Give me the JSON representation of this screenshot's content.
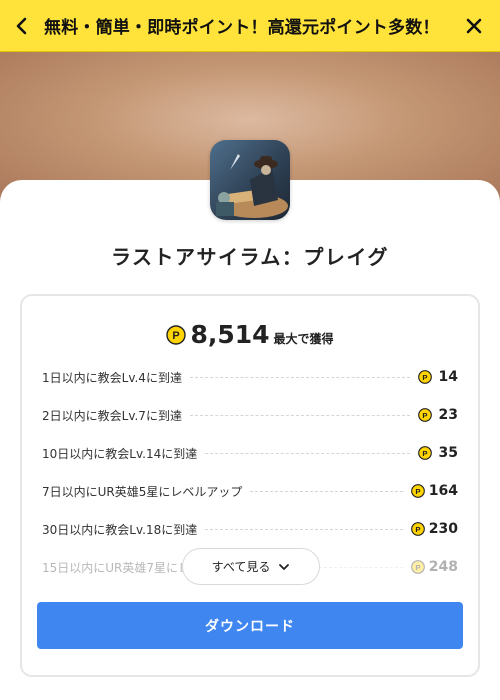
{
  "header": {
    "title": "無料・簡単・即時ポイント！高還元ポイント多数！",
    "back_icon": "chevron-left-icon",
    "close_icon": "close-icon",
    "background_color": "#ffe33a"
  },
  "app": {
    "name": "ラストアサイラム：プレイグ"
  },
  "reward": {
    "total": "8,514",
    "suffix": "最大で獲得",
    "point_icon": "point-coin-icon",
    "missions": [
      {
        "label": "1日以内に教会Lv.4に到達",
        "points": "14"
      },
      {
        "label": "2日以内に教会Lv.7に到達",
        "points": "23"
      },
      {
        "label": "10日以内に教会Lv.14に到達",
        "points": "35"
      },
      {
        "label": "7日以内にUR英雄5星にレベルアップ",
        "points": "164"
      },
      {
        "label": "30日以内に教会Lv.18に到達",
        "points": "230"
      },
      {
        "label": "15日以内にUR英雄7星にレベルアップ",
        "points": "248"
      }
    ]
  },
  "actions": {
    "see_all": "すべて見る",
    "download": "ダウンロード",
    "download_color": "#3f86f0"
  }
}
